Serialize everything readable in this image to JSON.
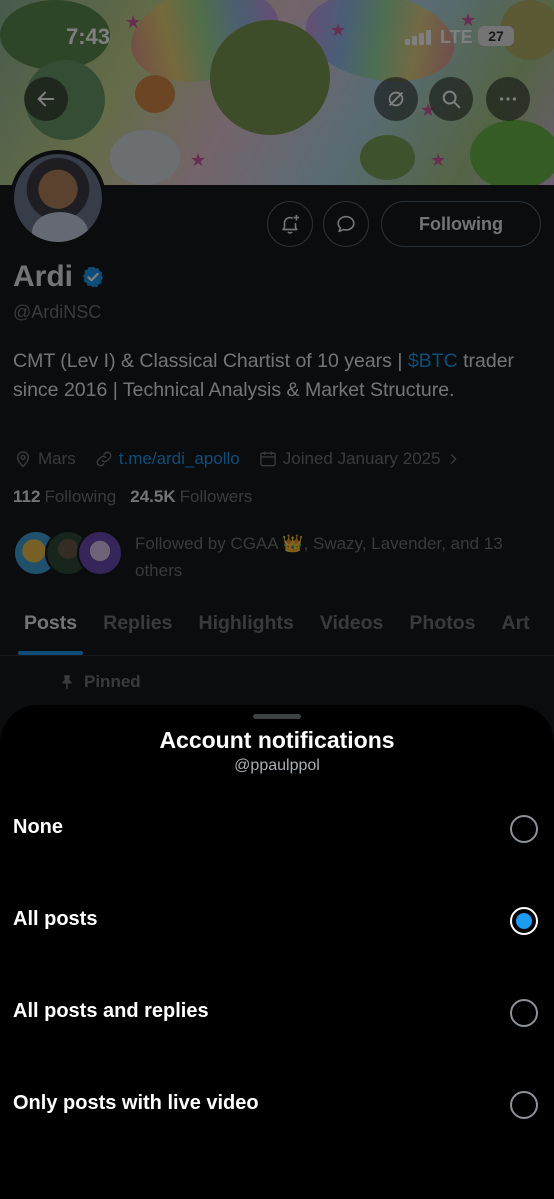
{
  "status_bar": {
    "time": "7:43",
    "network": "LTE",
    "battery": "27"
  },
  "profile": {
    "name": "Ardi",
    "handle": "@ArdiNSC",
    "bio_before": "CMT (Lev I) & Classical Chartist of 10 years | ",
    "bio_cashtag": "$BTC",
    "bio_after": " trader since 2016 | Technical Analysis & Market Structure.",
    "location": "Mars",
    "link": "t.me/ardi_apollo",
    "joined": "Joined January 2025",
    "following_count": "112",
    "following_label": "Following",
    "followers_count": "24.5K",
    "followers_label": "Followers",
    "followed_by": "Followed by CGAA 👑, Swazy, Lavender, and 13 others",
    "follow_button": "Following",
    "tabs": [
      "Posts",
      "Replies",
      "Highlights",
      "Videos",
      "Photos",
      "Art"
    ],
    "pinned_label": "Pinned"
  },
  "sheet": {
    "title": "Account notifications",
    "subtitle": "@ppaulppol",
    "options": [
      {
        "label": "None",
        "selected": false
      },
      {
        "label": "All posts",
        "selected": true
      },
      {
        "label": "All posts and replies",
        "selected": false
      },
      {
        "label": "Only posts with live video",
        "selected": false
      }
    ]
  },
  "colors": {
    "accent": "#1d9bf0",
    "sheet_bg": "#000000",
    "profile_bg": "#15181c",
    "muted_text": "#71767b"
  },
  "icons": [
    "back-arrow-icon",
    "no-sign-icon",
    "search-icon",
    "more-icon",
    "bell-plus-icon",
    "message-icon",
    "verified-badge-icon",
    "location-icon",
    "link-icon",
    "calendar-icon",
    "chevron-right-icon",
    "pin-icon"
  ]
}
